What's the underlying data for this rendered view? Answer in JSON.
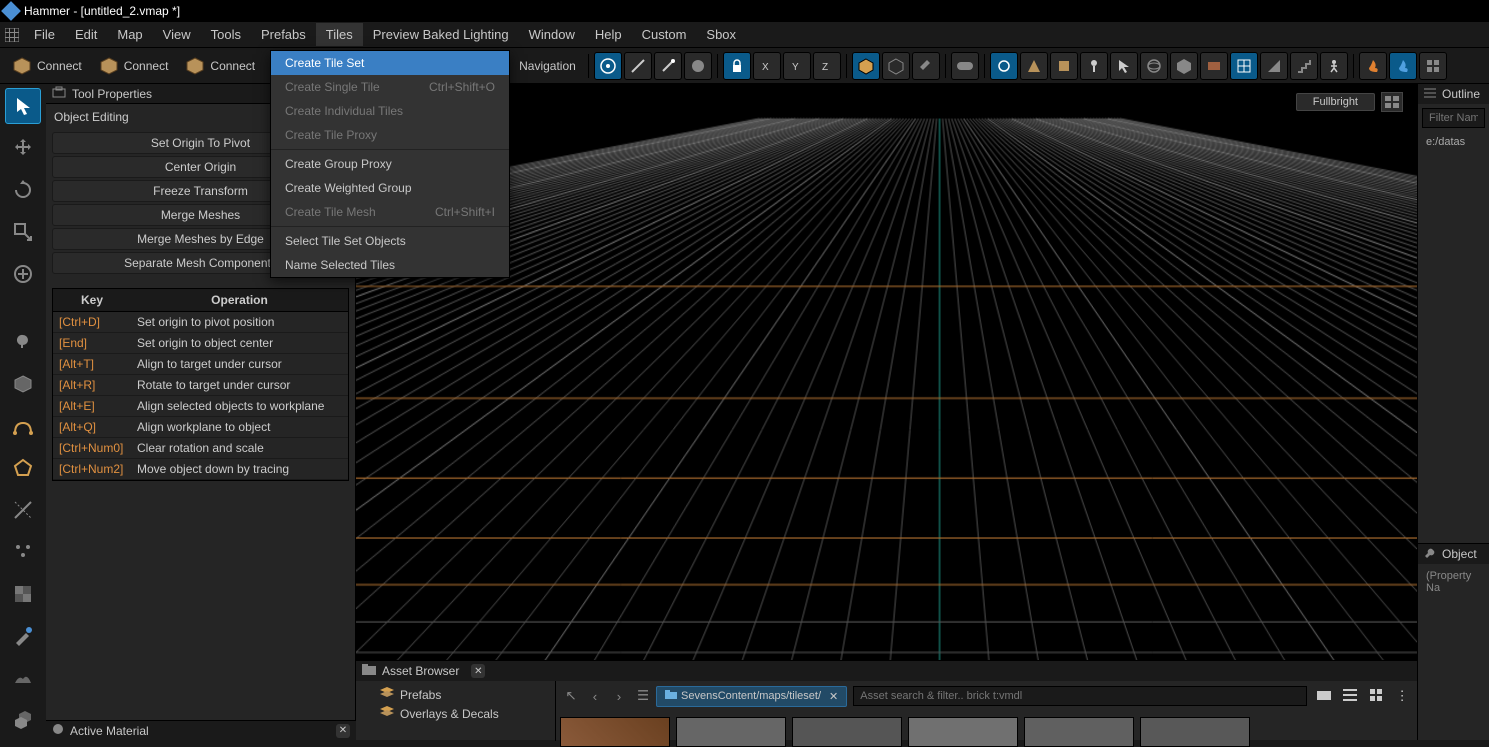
{
  "title": "Hammer - [untitled_2.vmap *]",
  "menu": [
    "File",
    "Edit",
    "Map",
    "View",
    "Tools",
    "Prefabs",
    "Tiles",
    "Preview Baked Lighting",
    "Window",
    "Help",
    "Custom",
    "Sbox"
  ],
  "menu_open_index": 6,
  "toolbar": {
    "connect1": "Connect",
    "connect2": "Connect",
    "connect3": "Connect",
    "navigation": "Navigation"
  },
  "dropdown": {
    "items": [
      {
        "label": "Create Tile Set",
        "shortcut": "",
        "hi": true
      },
      {
        "label": "Create Single Tile",
        "shortcut": "Ctrl+Shift+O",
        "disabled": true
      },
      {
        "label": "Create Individual Tiles",
        "shortcut": "",
        "disabled": true
      },
      {
        "label": "Create Tile Proxy",
        "shortcut": "",
        "disabled": true
      },
      {
        "sep": true
      },
      {
        "label": "Create Group Proxy",
        "shortcut": ""
      },
      {
        "label": "Create Weighted Group",
        "shortcut": ""
      },
      {
        "label": "Create Tile Mesh",
        "shortcut": "Ctrl+Shift+I",
        "disabled": true
      },
      {
        "sep": true
      },
      {
        "label": "Select Tile Set Objects",
        "shortcut": ""
      },
      {
        "label": "Name Selected Tiles",
        "shortcut": ""
      }
    ]
  },
  "tool_properties": {
    "title": "Tool Properties",
    "section": "Object Editing",
    "buttons": [
      "Set Origin To Pivot",
      "Center Origin",
      "Freeze Transform",
      "Merge Meshes",
      "Merge Meshes by Edge",
      "Separate Mesh Components"
    ],
    "table_headers": {
      "key": "Key",
      "op": "Operation"
    },
    "rows": [
      {
        "k": "[Ctrl+D]",
        "o": "Set origin to pivot position"
      },
      {
        "k": "[End]",
        "o": "Set origin to object center"
      },
      {
        "k": "[Alt+T]",
        "o": "Align to target under cursor"
      },
      {
        "k": "[Alt+R]",
        "o": "Rotate to target under cursor"
      },
      {
        "k": "[Alt+E]",
        "o": "Align selected objects to workplane"
      },
      {
        "k": "[Alt+Q]",
        "o": "Align workplane to object"
      },
      {
        "k": "[Ctrl+Num0]",
        "o": "Clear rotation and scale"
      },
      {
        "k": "[Ctrl+Num2]",
        "o": "Move object down by tracing"
      }
    ]
  },
  "viewport": {
    "mode": "Fullbright"
  },
  "outliner": {
    "title": "Outline",
    "filter_placeholder": "Filter Name.",
    "path": "e:/datas"
  },
  "object_props": {
    "title": "Object",
    "empty": "(Property Na"
  },
  "asset_browser": {
    "title": "Asset Browser",
    "tree": [
      "Prefabs",
      "Overlays & Decals"
    ],
    "breadcrumb": "SevensContent/maps/tileset/",
    "search_placeholder": "Asset search & filter.. brick t:vmdl"
  },
  "active_material": {
    "title": "Active Material"
  }
}
